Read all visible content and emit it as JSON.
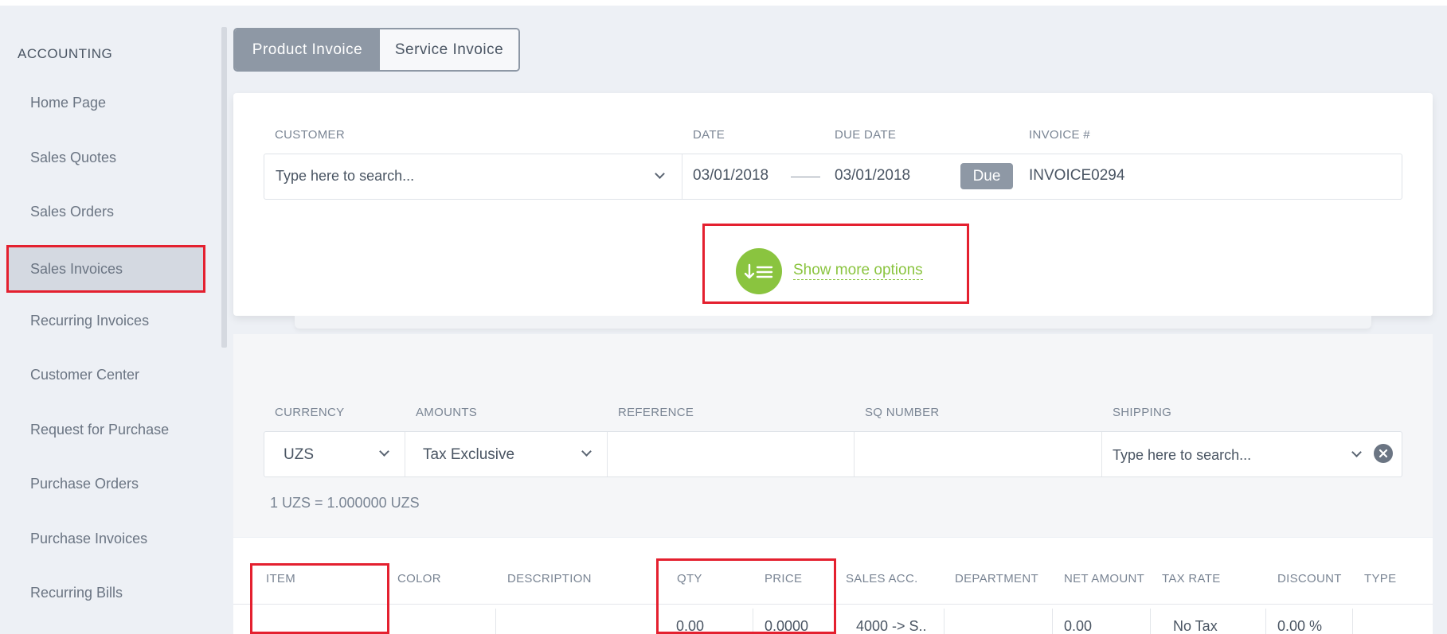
{
  "sidebar": {
    "heading": "ACCOUNTING",
    "items": [
      {
        "label": "Home Page"
      },
      {
        "label": "Sales Quotes"
      },
      {
        "label": "Sales Orders"
      },
      {
        "label": "Sales Invoices"
      },
      {
        "label": "Recurring Invoices"
      },
      {
        "label": "Customer Center"
      },
      {
        "label": "Request for Purchase"
      },
      {
        "label": "Purchase Orders"
      },
      {
        "label": "Purchase Invoices"
      },
      {
        "label": "Recurring Bills"
      }
    ],
    "active_item": "Sales Invoices"
  },
  "invoice_type": {
    "product_label": "Product Invoice",
    "service_label": "Service Invoice",
    "selected": "Product Invoice"
  },
  "header_fields": {
    "customer_label": "CUSTOMER",
    "customer_placeholder": "Type here to search...",
    "date_label": "DATE",
    "date_value": "03/01/2018",
    "due_date_label": "DUE DATE",
    "due_date_value": "03/01/2018",
    "due_badge": "Due",
    "invoice_label": "INVOICE #",
    "invoice_value": "INVOICE0294"
  },
  "more_options": {
    "label": "Show more options",
    "icon": "sort-list-icon"
  },
  "options_fields": {
    "currency_label": "CURRENCY",
    "currency_value": "UZS",
    "amounts_label": "AMOUNTS",
    "amounts_value": "Tax Exclusive",
    "reference_label": "REFERENCE",
    "reference_value": "",
    "sq_label": "SQ NUMBER",
    "sq_value": "",
    "shipping_label": "SHIPPING",
    "shipping_placeholder": "Type here to search...",
    "rate_text": "1 UZS = 1.000000 UZS"
  },
  "table": {
    "columns": [
      "ITEM",
      "COLOR",
      "DESCRIPTION",
      "QTY",
      "PRICE",
      "SALES ACC.",
      "DEPARTMENT",
      "NET AMOUNT",
      "TAX RATE",
      "DISCOUNT",
      "TYPE"
    ],
    "row": {
      "qty": "0.00",
      "price": "0.0000",
      "sales_acc": "4000 -> S..",
      "net_amount": "0.00",
      "tax_rate": "No Tax",
      "discount": "0.00 %"
    }
  },
  "colors": {
    "accent_green": "#8ac43f",
    "highlight_red": "#e4202f",
    "segment_gray": "#8e98a5"
  }
}
